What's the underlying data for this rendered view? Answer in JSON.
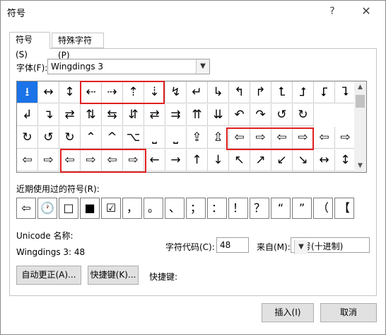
{
  "title": "符号",
  "title_buttons": {
    "help": "?",
    "close": "✕"
  },
  "tabs": [
    {
      "label": "符号(S)"
    },
    {
      "label": "特殊字符(P)"
    }
  ],
  "font": {
    "label": "字体(F):",
    "value": "Wingdings 3"
  },
  "symbols": [
    [
      "⭳",
      "↔",
      "↕",
      "⇠",
      "⇢",
      "⇡",
      "⇣",
      "↯",
      "↵",
      "↳",
      "↰",
      "↱",
      "⮤",
      "⮥",
      "⮦",
      "⮧"
    ],
    [
      "↲",
      "↴",
      "⇄",
      "⇅",
      "⇆",
      "⇵",
      "⇄",
      "⇉",
      "⇈",
      "⇊",
      "↶",
      "↷",
      "↺",
      "↻"
    ],
    [
      "↻",
      "↺",
      "↻",
      "⌃",
      "^",
      "⌥",
      "⎵",
      "⎵",
      "⇪",
      "⇫",
      "⇦",
      "⇨",
      "⇦",
      "⇨",
      "⇦",
      "⇨"
    ],
    [
      "⇦",
      "⇨",
      "⇦",
      "⇨",
      "⇦",
      "⇨",
      "←",
      "→",
      "↑",
      "↓",
      "↖",
      "↗",
      "↙",
      "↘",
      "↔",
      "↕"
    ]
  ],
  "recent": {
    "label": "近期使用过的符号(R):",
    "items": [
      "⇦",
      "🕐",
      "□",
      "■",
      "☑",
      "，",
      "。",
      "、",
      "；",
      "：",
      "！",
      "？",
      "“",
      "”",
      "（",
      "【"
    ]
  },
  "unicode": {
    "label": "Unicode 名称:",
    "value": "Wingdings 3: 48"
  },
  "code": {
    "label": "字符代码(C):",
    "value": "48"
  },
  "from": {
    "label": "来自(M):",
    "value": "符号(十进制)"
  },
  "buttons": {
    "autocorrect": "自动更正(A)...",
    "shortcut": "快捷键(K)...",
    "shortcut_label": "快捷键:",
    "insert": "插入(I)",
    "cancel": "取消"
  }
}
